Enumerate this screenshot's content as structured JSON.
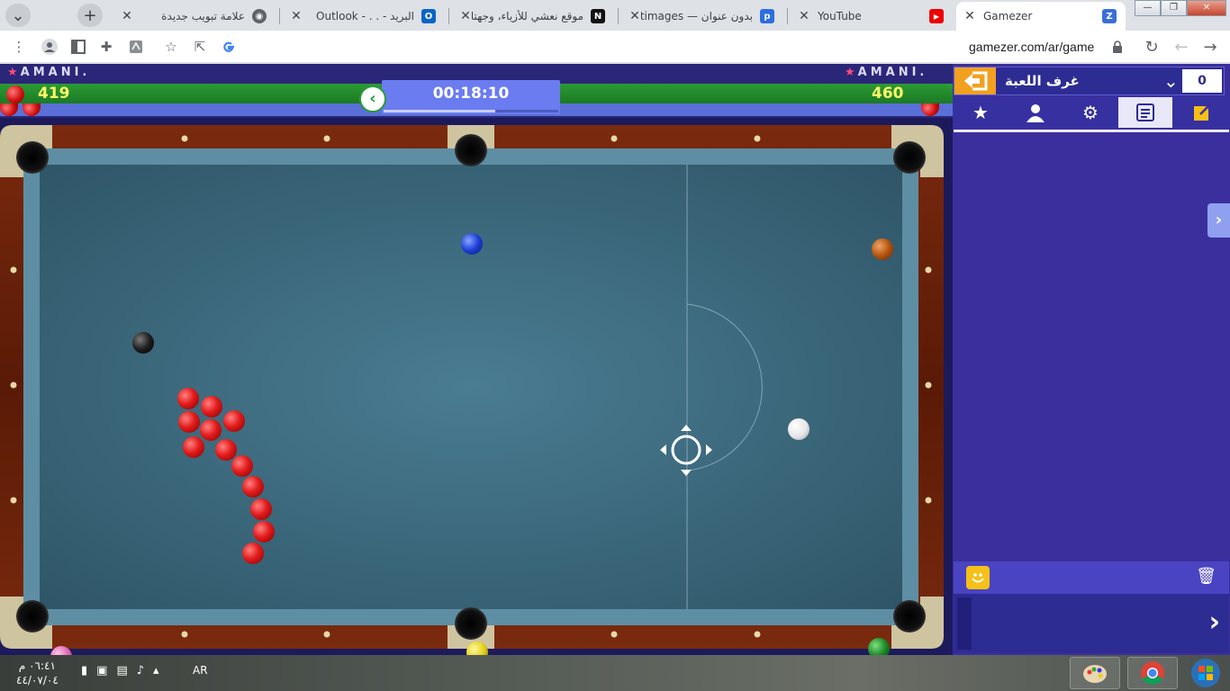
{
  "browser": {
    "tabs": [
      {
        "title": "Gamezer",
        "favicon": "gamezer-favicon",
        "active": true
      },
      {
        "title": "YouTube",
        "favicon": "youtube-favicon",
        "active": false
      },
      {
        "title": "بدون عنوان — Postimages",
        "favicon": "postimages-favicon",
        "active": false
      },
      {
        "title": "موقع نعشي للأزياء، وجهتك الأو",
        "favicon": "n-favicon",
        "active": false
      },
      {
        "title": "البريد - . . - Outlook",
        "favicon": "outlook-favicon",
        "active": false
      },
      {
        "title": "علامة تبويب جديدة",
        "favicon": "chrome-favicon",
        "active": false
      }
    ],
    "new_tab_label": "+",
    "url": "gamezer.com/ar/game"
  },
  "game": {
    "player_left": {
      "name": "AMANI.",
      "score": "419"
    },
    "player_right": {
      "name": "AMANI.",
      "score": "460"
    },
    "timer": "00:18:10",
    "timer_progress": 0.64,
    "table": {
      "felt_color": "#3e6a80",
      "balls": [
        {
          "color": "blue"
        },
        {
          "color": "brown"
        },
        {
          "color": "black"
        },
        {
          "color": "white"
        },
        {
          "color": "pink"
        },
        {
          "color": "yellow"
        },
        {
          "color": "green"
        },
        {
          "color": "red"
        },
        {
          "color": "red"
        },
        {
          "color": "red"
        },
        {
          "color": "red"
        },
        {
          "color": "red"
        },
        {
          "color": "red"
        },
        {
          "color": "red"
        },
        {
          "color": "red"
        },
        {
          "color": "red"
        },
        {
          "color": "red"
        },
        {
          "color": "red"
        },
        {
          "color": "red"
        },
        {
          "color": "red"
        }
      ]
    }
  },
  "side_panel": {
    "title": "غرف اللعبة",
    "count": "0",
    "tabs": [
      "star-icon",
      "user-icon",
      "gear-icon",
      "chat-icon",
      "popout-icon"
    ],
    "active_tab": "chat-icon"
  },
  "taskbar": {
    "time": "٠٦:٤١ م",
    "date": "٤٤/٠٧/٠٤",
    "language": "AR"
  }
}
